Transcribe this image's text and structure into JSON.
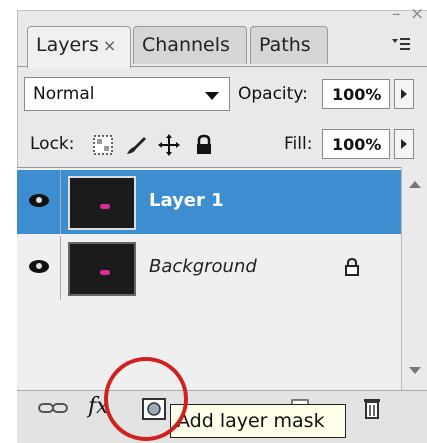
{
  "window": {
    "minimize_glyph": "–",
    "close_glyph": "×"
  },
  "tabs": [
    {
      "label": "Layers",
      "close": "×",
      "active": true
    },
    {
      "label": "Channels",
      "active": false
    },
    {
      "label": "Paths",
      "active": false
    }
  ],
  "blend_mode": {
    "value": "Normal",
    "options": [
      "Normal"
    ]
  },
  "opacity": {
    "label": "Opacity:",
    "value": "100%"
  },
  "lock": {
    "label": "Lock:",
    "icons": [
      "lock-transparent-icon",
      "lock-paint-icon",
      "lock-move-icon",
      "lock-all-icon"
    ]
  },
  "fill": {
    "label": "Fill:",
    "value": "100%"
  },
  "layers": [
    {
      "name": "Layer 1",
      "selected": true,
      "visible": true,
      "locked": false
    },
    {
      "name": "Background",
      "selected": false,
      "visible": true,
      "locked": true
    }
  ],
  "bottom_icons": [
    "link-layers-icon",
    "fx-icon",
    "layer-mask-icon",
    "adjustment-layer-icon",
    "group-folder-icon",
    "new-layer-icon",
    "trash-icon"
  ],
  "fx_label": "fx",
  "tooltip": {
    "text": "Add layer mask"
  },
  "colors": {
    "selection": "#3d8ed0",
    "highlight_circle": "#d02020",
    "thumb_figure": "#e0299b"
  }
}
